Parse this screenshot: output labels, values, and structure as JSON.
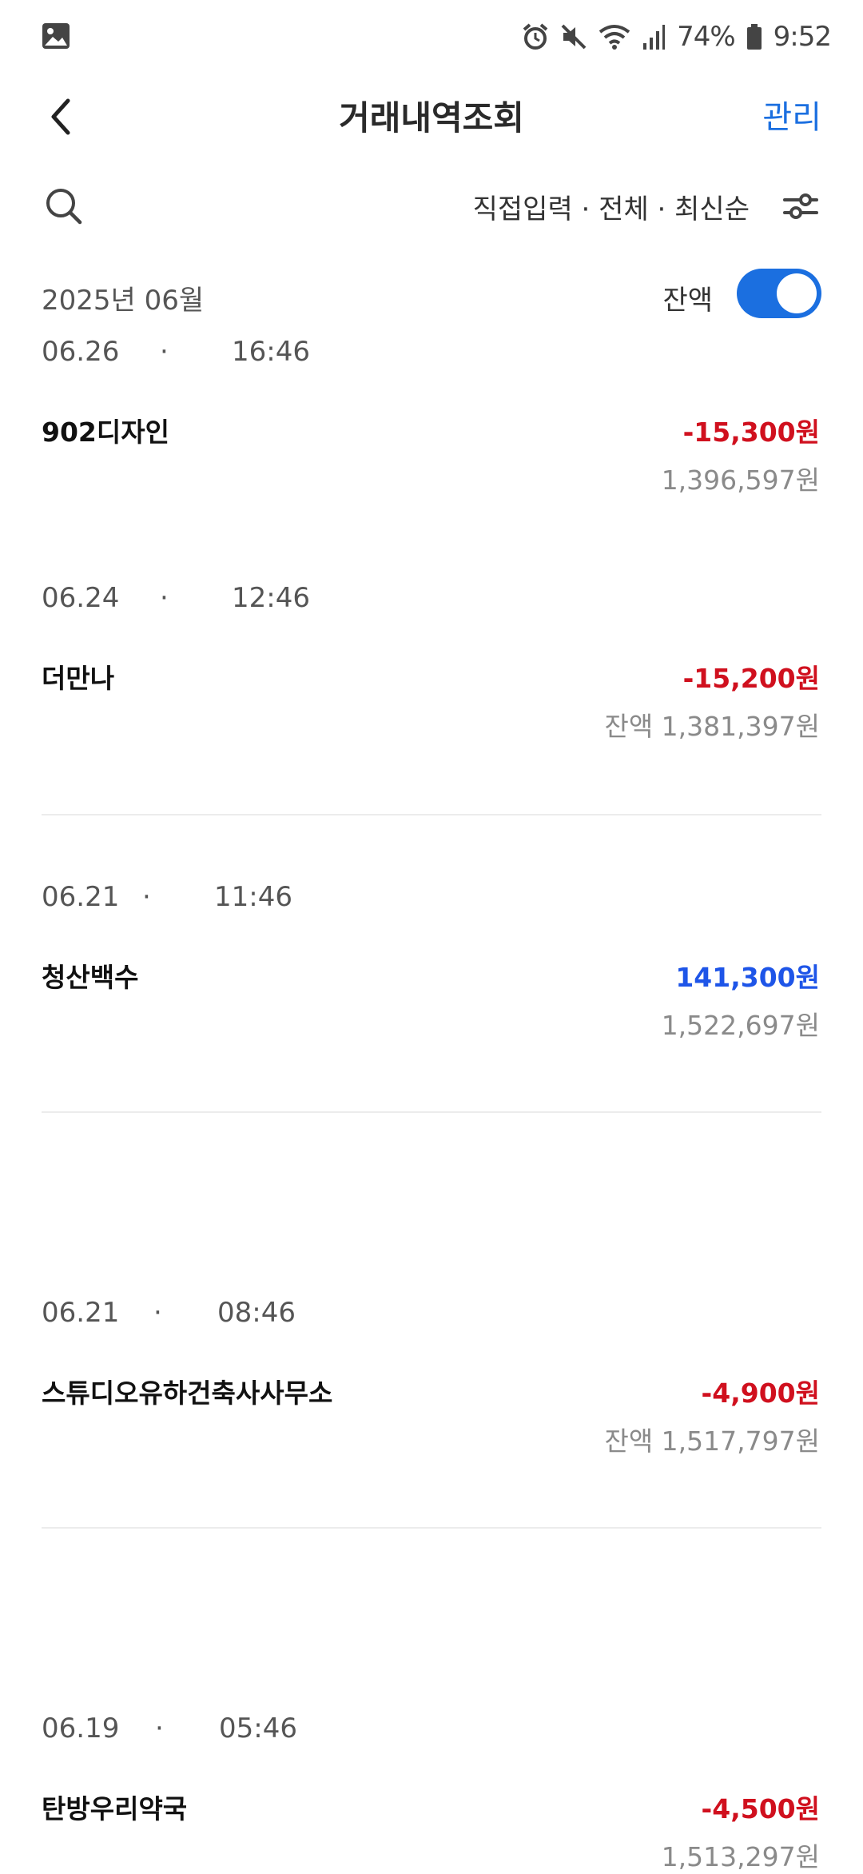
{
  "status_bar": {
    "battery": "74%",
    "time": "9:52",
    "icons": [
      "gallery-icon",
      "alarm-icon",
      "mute-icon",
      "wifi-icon",
      "signal-icon",
      "battery-icon"
    ]
  },
  "app_bar": {
    "title": "거래내역조회",
    "manage_label": "관리"
  },
  "filter": {
    "summary": "직접입력 · 전체 · 최신순"
  },
  "month": {
    "label": "2025년 06월",
    "balance_label": "잔액",
    "balance_toggle_on": true
  },
  "colors": {
    "accent": "#1b6fe0",
    "negative": "#d0101e",
    "positive": "#1e55e8"
  },
  "transactions": [
    {
      "date": "06.26",
      "time": "16:46",
      "name": "902디자인",
      "amount": "-15,300원",
      "balance": "1,396,597원",
      "type": "out"
    },
    {
      "date": "06.24",
      "time": "12:46",
      "name": "더만나",
      "amount": "-15,200원",
      "balance": "잔액 1,381,397원",
      "type": "out"
    },
    {
      "date": "06.21",
      "time": "11:46",
      "name": "청산백수",
      "amount": "141,300원",
      "balance": "1,522,697원",
      "type": "in"
    },
    {
      "date": "06.21",
      "time": "08:46",
      "name": "스튜디오유하건축사사무소",
      "amount": "-4,900원",
      "balance": "잔액 1,517,797원",
      "type": "out"
    },
    {
      "date": "06.19",
      "time": "05:46",
      "name": "탄방우리약국",
      "amount": "-4,500원",
      "balance": "1,513,297원",
      "type": "out"
    }
  ]
}
